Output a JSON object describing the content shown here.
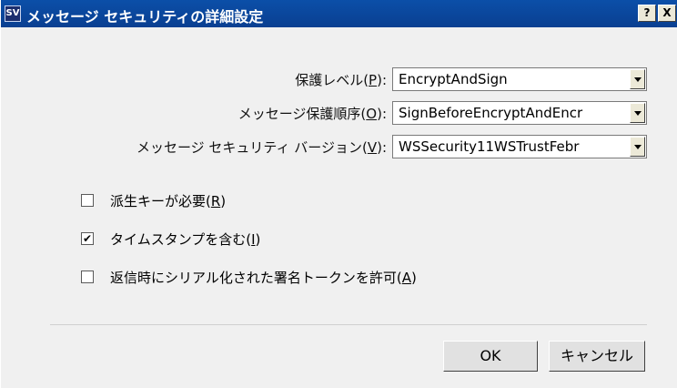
{
  "window": {
    "title": "メッセージ セキュリティの詳細設定",
    "icon_text": "SV",
    "help_button": "?",
    "close_button": "X"
  },
  "fields": [
    {
      "label_pre": "保護レベル(",
      "mnemonic": "P",
      "label_post": "):",
      "value": "EncryptAndSign"
    },
    {
      "label_pre": "メッセージ保護順序(",
      "mnemonic": "O",
      "label_post": "):",
      "value": "SignBeforeEncryptAndEncr"
    },
    {
      "label_pre": "メッセージ セキュリティ バージョン(",
      "mnemonic": "V",
      "label_post": "):",
      "value": "WSSecurity11WSTrustFebr"
    }
  ],
  "checkboxes": [
    {
      "label_pre": "派生キーが必要(",
      "mnemonic": "R",
      "label_post": ")",
      "checked": false
    },
    {
      "label_pre": "タイムスタンプを含む(",
      "mnemonic": "I",
      "label_post": ")",
      "checked": true
    },
    {
      "label_pre": "返信時にシリアル化された署名トークンを許可(",
      "mnemonic": "A",
      "label_post": ")",
      "checked": false
    }
  ],
  "buttons": {
    "ok": "OK",
    "cancel": "キャンセル"
  },
  "check_mark": "✔"
}
